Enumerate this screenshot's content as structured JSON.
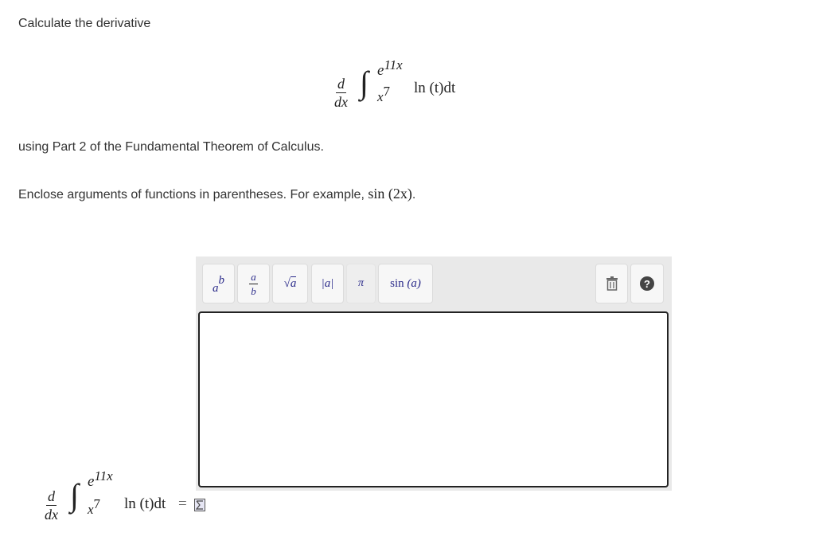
{
  "prompt": {
    "heading": "Calculate the derivative",
    "method": "using Part 2 of the Fundamental Theorem of Calculus.",
    "instructions": "Enclose arguments of functions in parentheses. For example, ",
    "example": "sin (2x)",
    "example_end": "."
  },
  "integral": {
    "d": "d",
    "dx": "dx",
    "upper_base": "e",
    "upper_exp": "11x",
    "lower_base": "x",
    "lower_exp": "7",
    "integrand": "ln (t)dt"
  },
  "toolbar": {
    "power_base": "a",
    "power_exp": "b",
    "frac_num": "a",
    "frac_den": "b",
    "sqrt_arg": "a",
    "abs_label": "|a|",
    "pi_label": "π",
    "sin_fn": "sin",
    "sin_arg": "(a)",
    "help_label": "?"
  },
  "answer": {
    "equals": "=",
    "value": ""
  }
}
